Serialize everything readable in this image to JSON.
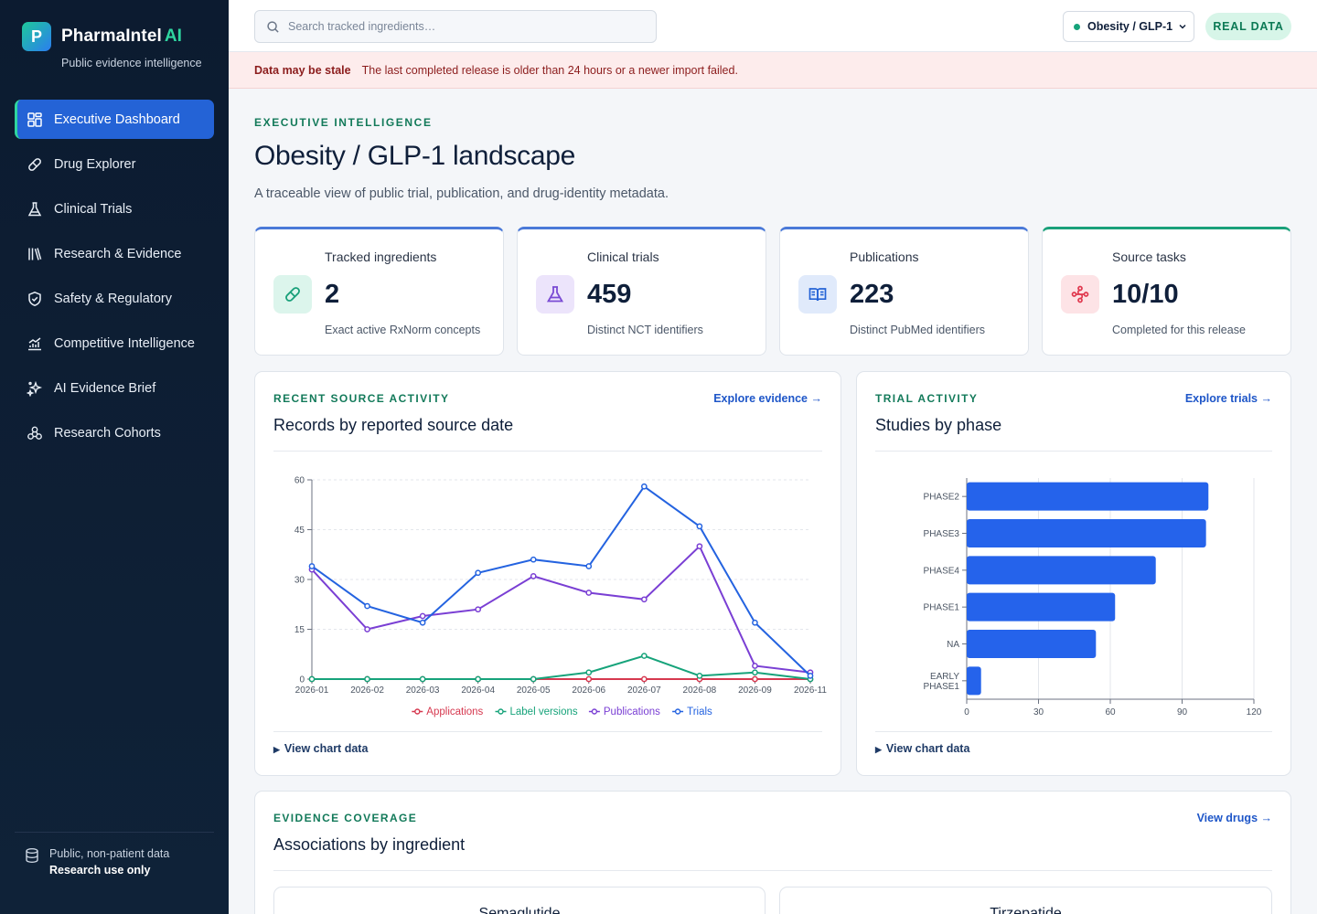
{
  "sidebar": {
    "brand_letter": "P",
    "brand_name": "PharmaIntel",
    "brand_ai": "AI",
    "brand_sub": "Public evidence intelligence",
    "items": [
      {
        "label": "Executive Dashboard",
        "icon": "dashboard-icon",
        "active": true
      },
      {
        "label": "Drug Explorer",
        "icon": "pill-icon"
      },
      {
        "label": "Clinical Trials",
        "icon": "flask-icon"
      },
      {
        "label": "Research & Evidence",
        "icon": "library-icon"
      },
      {
        "label": "Safety & Regulatory",
        "icon": "shield-check-icon"
      },
      {
        "label": "Competitive Intelligence",
        "icon": "trend-chart-icon"
      },
      {
        "label": "AI Evidence Brief",
        "icon": "sparkles-icon"
      },
      {
        "label": "Research Cohorts",
        "icon": "cohorts-icon"
      }
    ],
    "footer_line1": "Public, non-patient data",
    "footer_line2": "Research use only"
  },
  "topbar": {
    "search_placeholder": "Search tracked ingredients…",
    "scope_label": "Obesity / GLP-1",
    "badge": "REAL DATA"
  },
  "banner": {
    "title": "Data may be stale",
    "message": "The last completed release is older than 24 hours or a newer import failed."
  },
  "header": {
    "eyebrow": "EXECUTIVE INTELLIGENCE",
    "title": "Obesity / GLP-1 landscape",
    "subtitle": "A traceable view of public trial, publication, and drug-identity metadata."
  },
  "kpis": [
    {
      "label": "Tracked ingredients",
      "value": "2",
      "note": "Exact active RxNorm concepts",
      "icon": "pill-icon",
      "color": "#19a07a"
    },
    {
      "label": "Clinical trials",
      "value": "459",
      "note": "Distinct NCT identifiers",
      "icon": "flask-icon",
      "color": "#7a4bd4"
    },
    {
      "label": "Publications",
      "value": "223",
      "note": "Distinct PubMed identifiers",
      "icon": "book-open-icon",
      "color": "#2463d6"
    },
    {
      "label": "Source tasks",
      "value": "10/10",
      "note": "Completed for this release",
      "icon": "workflow-icon",
      "color": "#e0384e"
    }
  ],
  "activity_panel": {
    "eyebrow": "RECENT SOURCE ACTIVITY",
    "title": "Records by reported source date",
    "link": "Explore evidence →",
    "details": "View chart data"
  },
  "trial_panel": {
    "eyebrow": "TRIAL ACTIVITY",
    "title": "Studies by phase",
    "link": "Explore trials →",
    "details": "View chart data"
  },
  "coverage_panel": {
    "eyebrow": "EVIDENCE COVERAGE",
    "title": "Associations by ingredient",
    "link": "View drugs →",
    "cards": [
      "Semaglutide",
      "Tirzepatide"
    ]
  },
  "chart_data": [
    {
      "type": "line",
      "title": "Records by reported source date",
      "x": [
        "2026-01",
        "2026-02",
        "2026-03",
        "2026-04",
        "2026-05",
        "2026-06",
        "2026-07",
        "2026-08",
        "2026-09",
        "2026-11"
      ],
      "ylim": [
        0,
        60
      ],
      "yticks": [
        0,
        15,
        30,
        45,
        60
      ],
      "grid": true,
      "legend": "bottom",
      "series": [
        {
          "name": "Applications",
          "color": "#d6384f",
          "values": [
            0,
            0,
            0,
            0,
            0,
            0,
            0,
            0,
            0,
            0
          ]
        },
        {
          "name": "Label versions",
          "color": "#16a37a",
          "values": [
            0,
            0,
            0,
            0,
            0,
            2,
            7,
            1,
            2,
            0
          ]
        },
        {
          "name": "Publications",
          "color": "#7a3fd4",
          "values": [
            33,
            15,
            19,
            21,
            31,
            26,
            24,
            40,
            4,
            2
          ]
        },
        {
          "name": "Trials",
          "color": "#2463e0",
          "values": [
            34,
            22,
            17,
            32,
            36,
            34,
            58,
            46,
            17,
            1
          ]
        }
      ]
    },
    {
      "type": "bar",
      "orientation": "horizontal",
      "title": "Studies by phase",
      "categories": [
        "PHASE2",
        "PHASE3",
        "PHASE4",
        "PHASE1",
        "NA",
        "EARLY PHASE1"
      ],
      "values": [
        101,
        100,
        79,
        62,
        54,
        6
      ],
      "xlim": [
        0,
        120
      ],
      "xticks": [
        0,
        30,
        60,
        90,
        120
      ],
      "color": "#2563eb",
      "grid": true
    }
  ]
}
